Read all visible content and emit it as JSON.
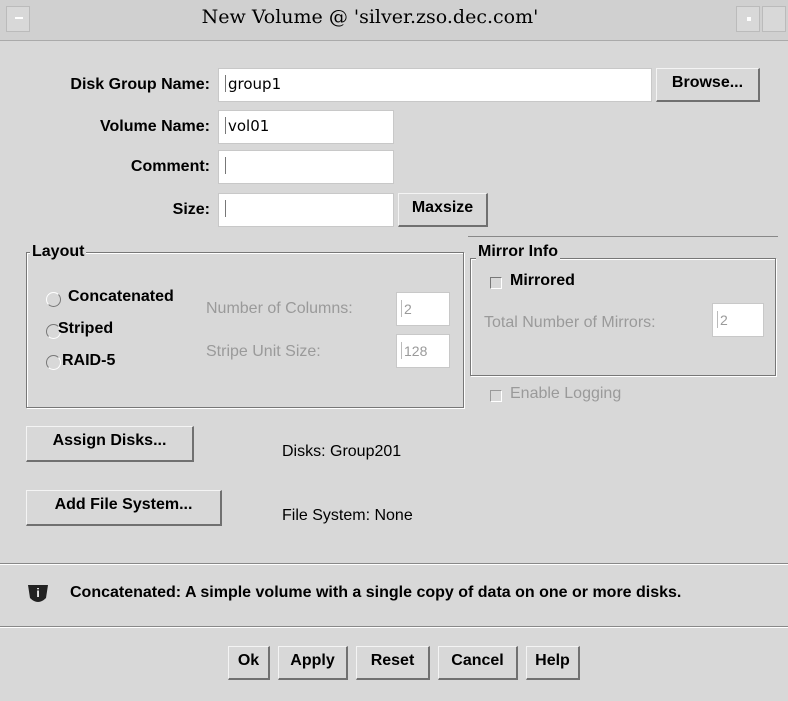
{
  "window": {
    "title": "New Volume @ 'silver.zso.dec.com'"
  },
  "form": {
    "disk_group_label": "Disk Group Name:",
    "disk_group_value": "group1",
    "browse_label": "Browse...",
    "volume_name_label": "Volume Name:",
    "volume_name_value": "vol01",
    "comment_label": "Comment:",
    "comment_value": "",
    "size_label": "Size:",
    "size_value": "",
    "maxsize_label": "Maxsize"
  },
  "layout": {
    "title": "Layout",
    "options": [
      "Concatenated",
      "Striped",
      "RAID-5"
    ],
    "selected": "Concatenated",
    "columns_label": "Number of Columns:",
    "columns_value": "2",
    "stripe_label": "Stripe Unit Size:",
    "stripe_value": "128"
  },
  "mirror": {
    "title": "Mirror Info",
    "mirrored_label": "Mirrored",
    "mirrored_checked": false,
    "total_label": "Total Number of Mirrors:",
    "total_value": "2",
    "logging_label": "Enable Logging",
    "logging_checked": false
  },
  "disks": {
    "assign_label": "Assign Disks...",
    "status": "Disks:  Group201"
  },
  "filesystem": {
    "add_label": "Add File System...",
    "status": "File System:  None"
  },
  "info": {
    "icon": "info-icon",
    "message": "Concatenated: A simple volume with a single copy of data on one or more disks."
  },
  "actions": {
    "ok": "Ok",
    "apply": "Apply",
    "reset": "Reset",
    "cancel": "Cancel",
    "help": "Help"
  },
  "colors": {
    "background": "#d8d8d8",
    "disabled_text": "#9a9a9a"
  }
}
